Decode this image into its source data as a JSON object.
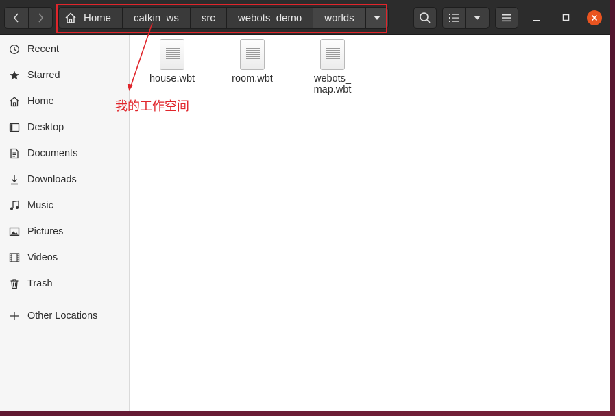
{
  "header": {
    "breadcrumbs": [
      "Home",
      "catkin_ws",
      "src",
      "webots_demo",
      "worlds"
    ]
  },
  "sidebar": {
    "items": [
      {
        "label": "Recent",
        "icon": "clock-icon"
      },
      {
        "label": "Starred",
        "icon": "star-icon"
      },
      {
        "label": "Home",
        "icon": "home-icon"
      },
      {
        "label": "Desktop",
        "icon": "desktop-icon"
      },
      {
        "label": "Documents",
        "icon": "document-icon"
      },
      {
        "label": "Downloads",
        "icon": "download-icon"
      },
      {
        "label": "Music",
        "icon": "music-icon"
      },
      {
        "label": "Pictures",
        "icon": "picture-icon"
      },
      {
        "label": "Videos",
        "icon": "video-icon"
      },
      {
        "label": "Trash",
        "icon": "trash-icon"
      }
    ],
    "other_locations": "Other Locations"
  },
  "files": [
    {
      "name": "house.wbt"
    },
    {
      "name": "room.wbt"
    },
    {
      "name": "webots_\nmap.wbt"
    }
  ],
  "annotation": {
    "text": "我的工作空间",
    "color": "#e0252b"
  },
  "colors": {
    "headerbar": "#2c2c2c",
    "close_button": "#e95420"
  }
}
